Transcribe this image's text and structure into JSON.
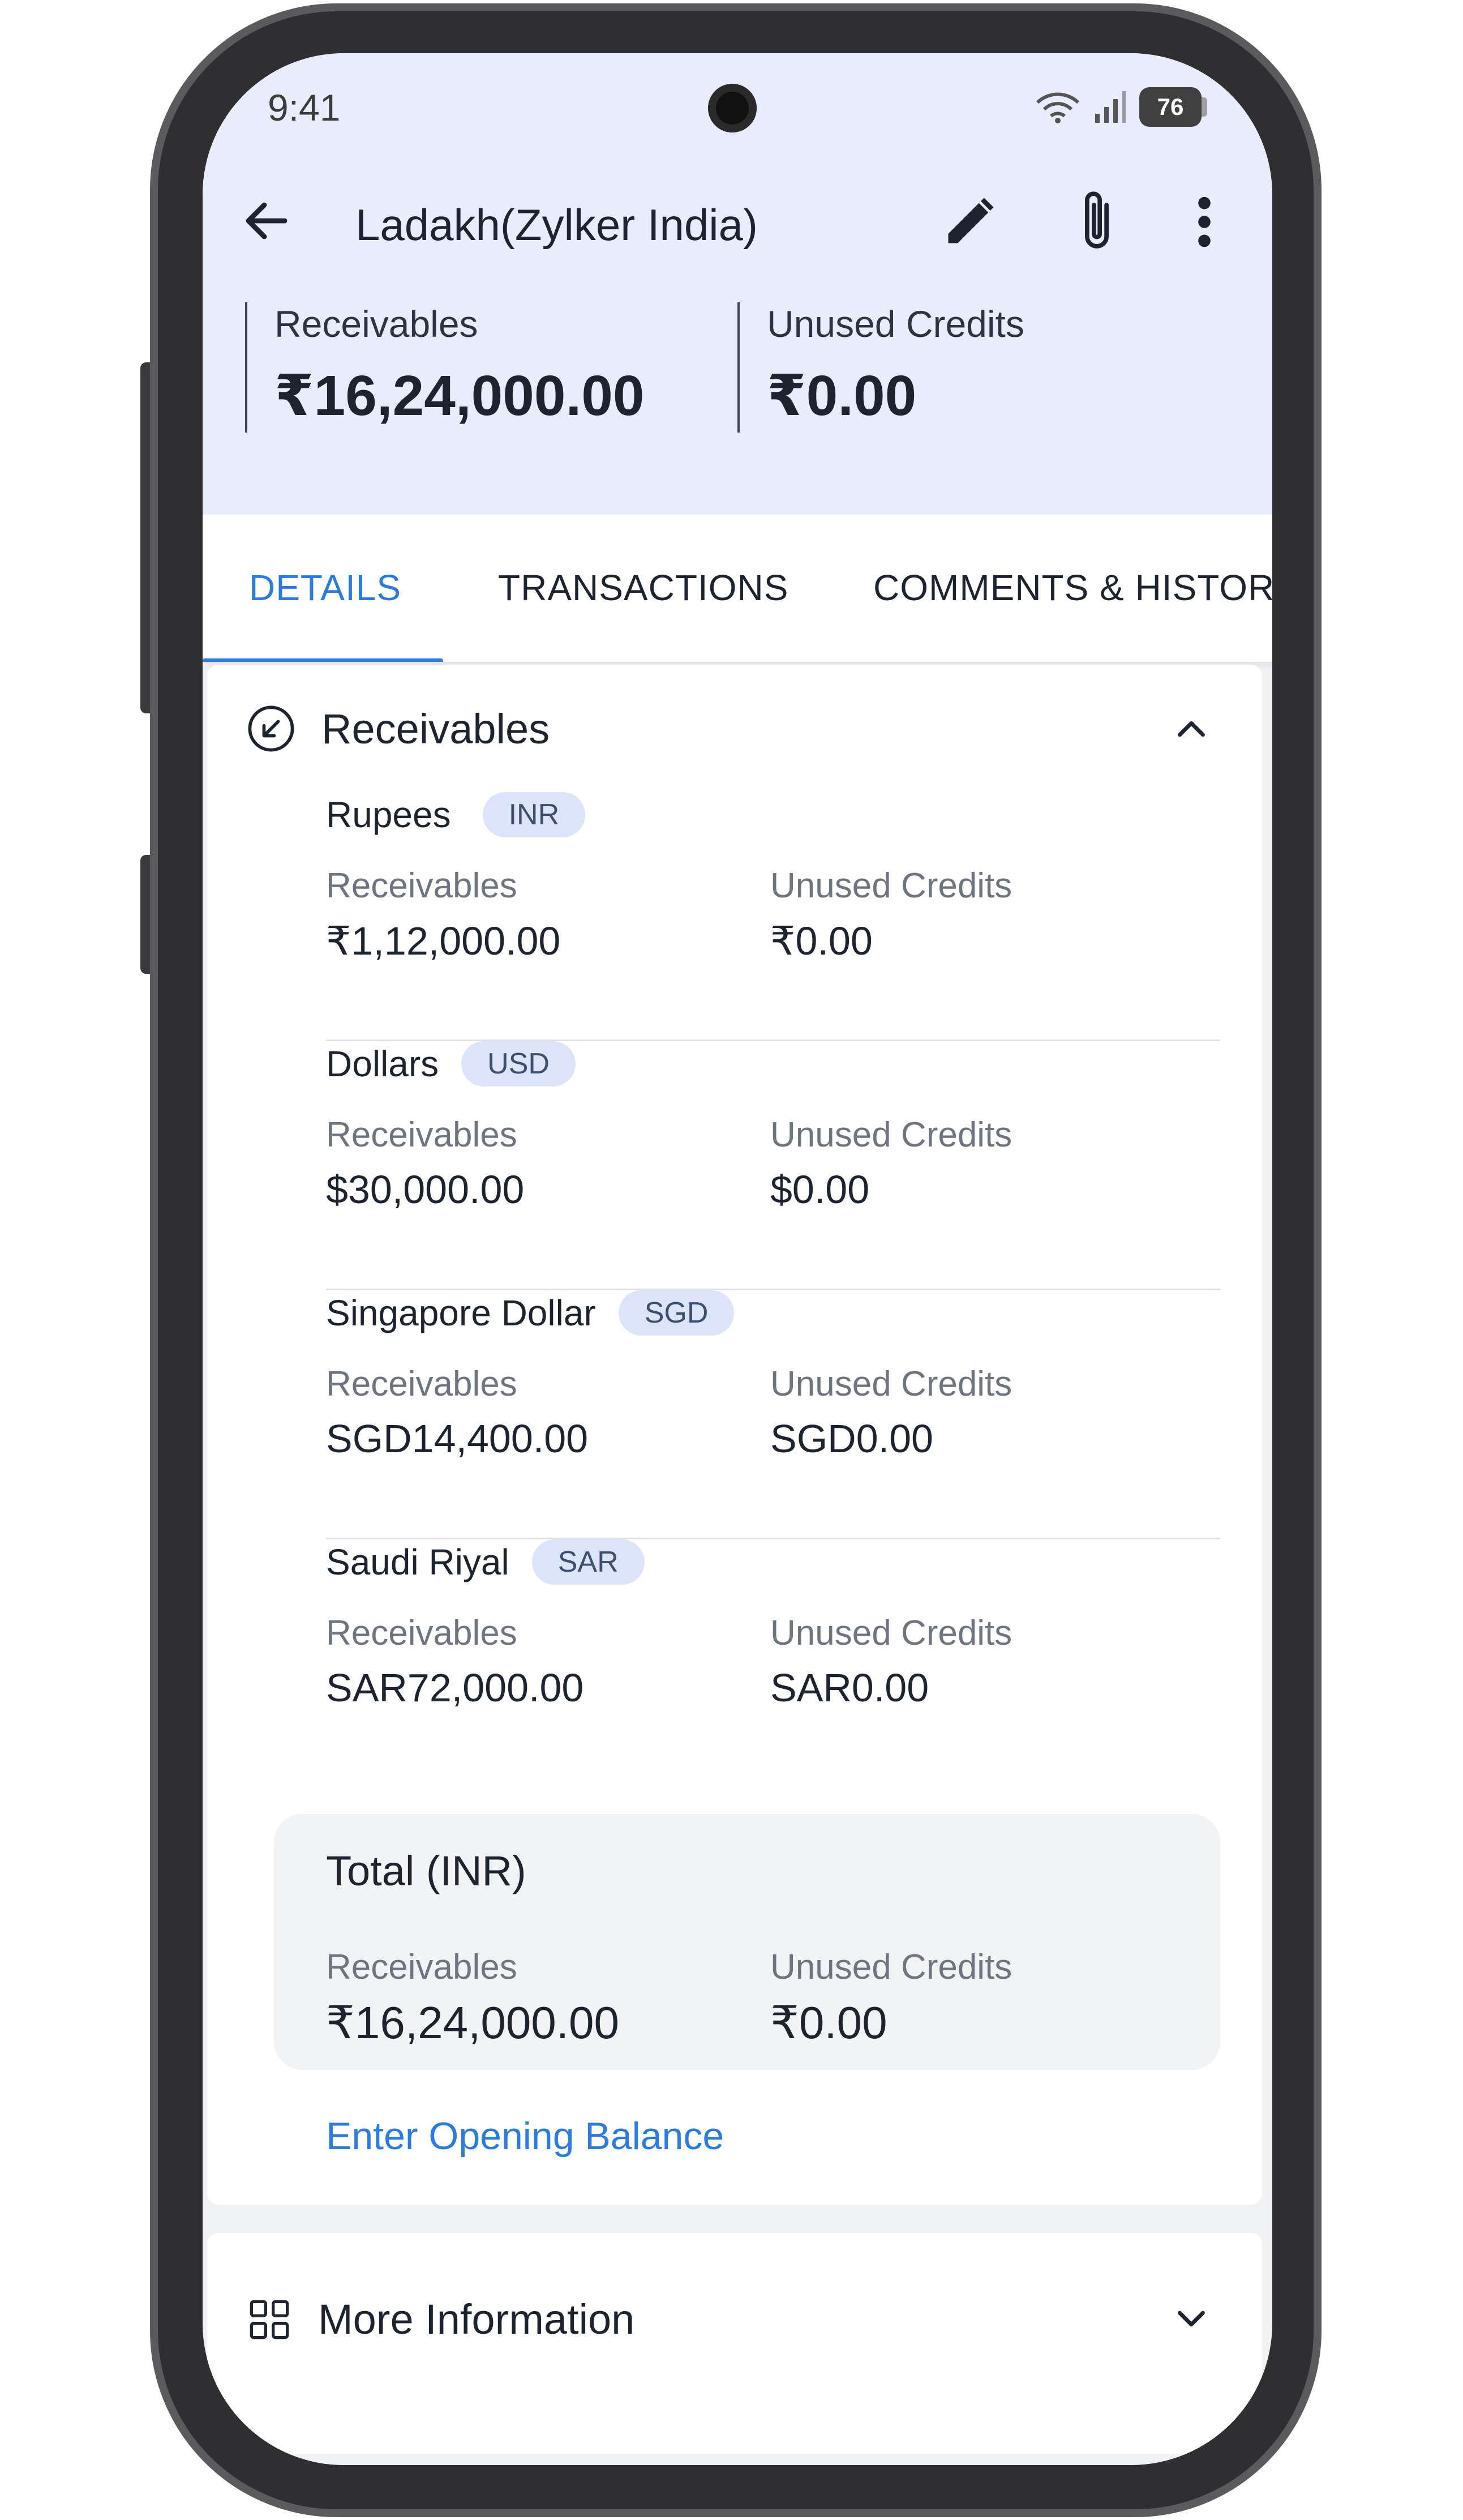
{
  "status_bar": {
    "time": "9:41",
    "battery": "76"
  },
  "header": {
    "title": "Ladakh(Zylker India)",
    "icons": [
      "back-arrow-icon",
      "edit-pencil-icon",
      "attachment-clip-icon",
      "more-vertical-icon"
    ]
  },
  "summary": {
    "receivables_label": "Receivables",
    "receivables_value": "₹16,24,000.00",
    "credits_label": "Unused Credits",
    "credits_value": "₹0.00"
  },
  "tabs": [
    {
      "label": "DETAILS",
      "active": true
    },
    {
      "label": "TRANSACTIONS",
      "active": false
    },
    {
      "label": "COMMENTS & HISTORY",
      "active": false
    }
  ],
  "receivables_section": {
    "title": "Receivables",
    "currencies": [
      {
        "name": "Rupees",
        "code": "INR",
        "receivables_label": "Receivables",
        "receivables": "₹1,12,000.00",
        "credits_label": "Unused Credits",
        "credits": "₹0.00"
      },
      {
        "name": "Dollars",
        "code": "USD",
        "receivables_label": "Receivables",
        "receivables": "$30,000.00",
        "credits_label": "Unused Credits",
        "credits": "$0.00"
      },
      {
        "name": "Singapore Dollar",
        "code": "SGD",
        "receivables_label": "Receivables",
        "receivables": "SGD14,400.00",
        "credits_label": "Unused Credits",
        "credits": "SGD0.00"
      },
      {
        "name": "Saudi Riyal",
        "code": "SAR",
        "receivables_label": "Receivables",
        "receivables": "SAR72,000.00",
        "credits_label": "Unused Credits",
        "credits": "SAR0.00"
      }
    ],
    "total": {
      "title": "Total (INR)",
      "receivables_label": "Receivables",
      "receivables": "₹16,24,000.00",
      "credits_label": "Unused Credits",
      "credits": "₹0.00"
    },
    "opening_balance_link": "Enter Opening Balance"
  },
  "more_info": {
    "title": "More Information"
  },
  "colors": {
    "header_bg": "#e9ecfc",
    "accent": "#2c7ce0",
    "badge_bg": "#dbe4f8",
    "text_primary": "#1d2430",
    "text_secondary": "#6f7580"
  }
}
